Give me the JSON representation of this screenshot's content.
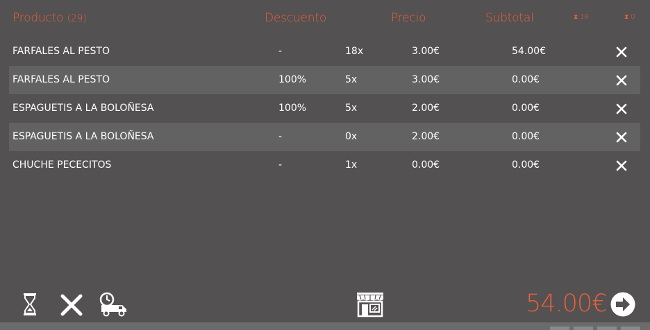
{
  "header": {
    "product_label": "Producto",
    "product_count": "(29)",
    "discount": "Descuento",
    "price": "Precio",
    "subtotal": "Subtotal",
    "badge_a": "18",
    "badge_b": "0"
  },
  "rows": [
    {
      "name": "FARFALES AL PESTO",
      "discount": "-",
      "qty": "18x",
      "price": "3.00€",
      "subtotal": "54.00€"
    },
    {
      "name": "FARFALES AL PESTO",
      "discount": "100%",
      "qty": "5x",
      "price": "3.00€",
      "subtotal": "0.00€"
    },
    {
      "name": "ESPAGUETIS A LA BOLOÑESA",
      "discount": "100%",
      "qty": "5x",
      "price": "2.00€",
      "subtotal": "0.00€"
    },
    {
      "name": "ESPAGUETIS A LA BOLOÑESA",
      "discount": "-",
      "qty": "0x",
      "price": "2.00€",
      "subtotal": "0.00€"
    },
    {
      "name": "CHUCHE PECECITOS",
      "discount": "-",
      "qty": "1x",
      "price": "0.00€",
      "subtotal": "0.00€"
    }
  ],
  "footer": {
    "total": "54.00€"
  },
  "colors": {
    "background": "#535151",
    "alt_row": "#636262",
    "accent": "#e8603a"
  },
  "icons": [
    "hourglass-icon",
    "close-icon",
    "delivery-truck-icon",
    "shop-icon",
    "arrow-right-circle-icon"
  ]
}
